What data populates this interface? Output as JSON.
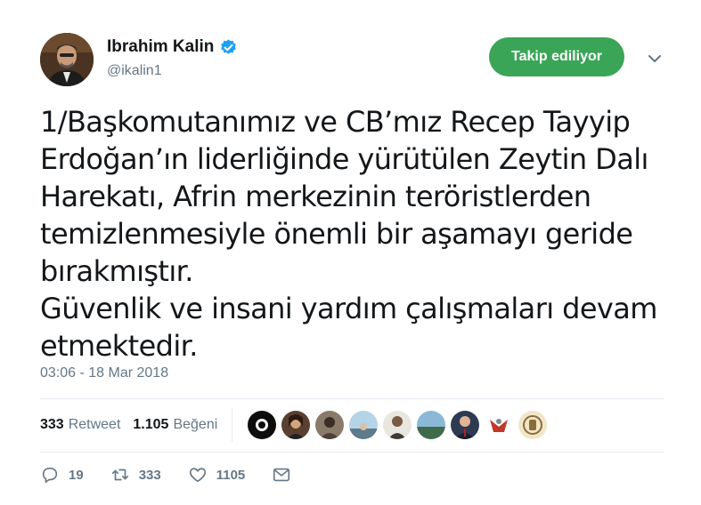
{
  "author": {
    "name": "Ibrahim Kalin",
    "handle": "@ikalin1"
  },
  "follow_button_label": "Takip ediliyor",
  "tweet": {
    "text": "1/Başkomutanımız ve CB’mız Recep Tayyip\nErdoğan’ın liderliğinde yürütülen Zeytin Dalı\nHarekatı, Afrin merkezinin teröristlerden\ntemizlenmesiyle önemli bir aşamayı geride\nbırakmıştır.\nGüvenlik ve insani yardım çalışmaları devam\netmektedir.",
    "timestamp": "03:06 - 18 Mar 2018"
  },
  "stats": {
    "retweet_count": "333",
    "retweet_label": "Retweet",
    "like_count": "1.105",
    "like_label": "Beğeni"
  },
  "actions": {
    "reply_count": "19",
    "retweet_count": "333",
    "like_count": "1105"
  },
  "colors": {
    "follow_green": "#3aa556",
    "verified_blue": "#1da1f2",
    "muted_gray": "#657786"
  }
}
